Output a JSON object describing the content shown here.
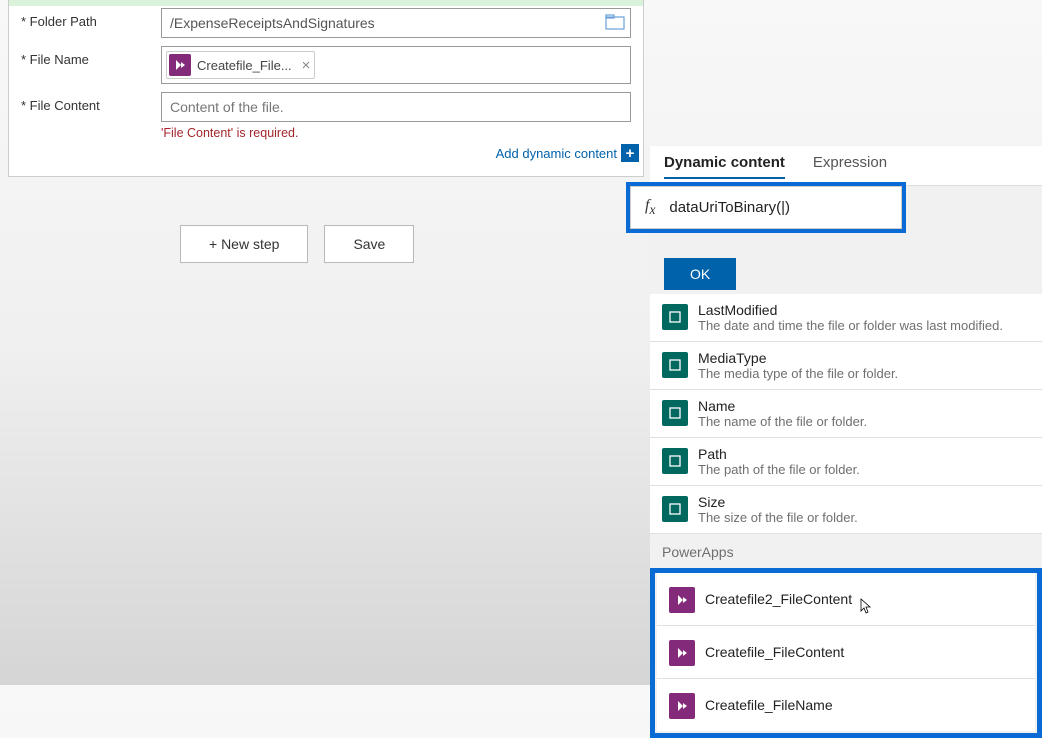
{
  "form": {
    "folderPath": {
      "label": "Folder Path",
      "value": "/ExpenseReceiptsAndSignatures"
    },
    "fileName": {
      "label": "File Name",
      "token": "Createfile_File..."
    },
    "fileContent": {
      "label": "File Content",
      "placeholder": "Content of the file.",
      "error": "'File Content' is required."
    },
    "addDynamic": "Add dynamic content"
  },
  "buttons": {
    "newStep": "+ New step",
    "save": "Save"
  },
  "flyout": {
    "tabs": {
      "dynamic": "Dynamic content",
      "expression": "Expression"
    },
    "expression": "dataUriToBinary(|)",
    "ok": "OK",
    "items": [
      {
        "title": "LastModified",
        "desc": "The date and time the file or folder was last modified."
      },
      {
        "title": "MediaType",
        "desc": "The media type of the file or folder."
      },
      {
        "title": "Name",
        "desc": "The name of the file or folder."
      },
      {
        "title": "Path",
        "desc": "The path of the file or folder."
      },
      {
        "title": "Size",
        "desc": "The size of the file or folder."
      }
    ],
    "groupLabel": "PowerApps",
    "paItems": [
      {
        "title": "Createfile2_FileContent"
      },
      {
        "title": "Createfile_FileContent"
      },
      {
        "title": "Createfile_FileName"
      }
    ]
  }
}
